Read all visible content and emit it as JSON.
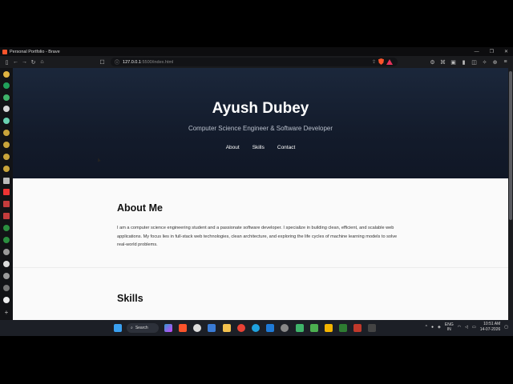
{
  "window": {
    "title": "Personal Portfolio - Brave",
    "controls": [
      "—",
      "❐",
      "✕"
    ]
  },
  "toolbar": {
    "back": "←",
    "forward": "→",
    "reload": "↻",
    "home": "⌂",
    "bookmark": "☐",
    "url_host": "127.0.0.1",
    "url_rest": ":5500/index.html",
    "menu": "≡"
  },
  "hero": {
    "name": "Ayush Dubey",
    "subtitle": "Computer Science Engineer & Software Developer",
    "nav": [
      "About",
      "Skills",
      "Contact"
    ]
  },
  "about": {
    "heading": "About Me",
    "text": "I am a computer science engineering student and a passionate software developer. I specialize in building clean, efficient, and scalable web applications. My focus lies in full-stack web technologies, clean architecture, and exploring the life cycles of machine learning models to solve real-world problems."
  },
  "skills": {
    "heading": "Skills"
  },
  "taskbar": {
    "search_label": "Search",
    "lang_top": "ENG",
    "lang_bottom": "IN",
    "time": "10:51 AM",
    "date": "14-07-2026"
  },
  "colors": {
    "hero_bg": "#1b273b",
    "brave_orange": "#fb542b",
    "page_bg": "#fafafa"
  }
}
